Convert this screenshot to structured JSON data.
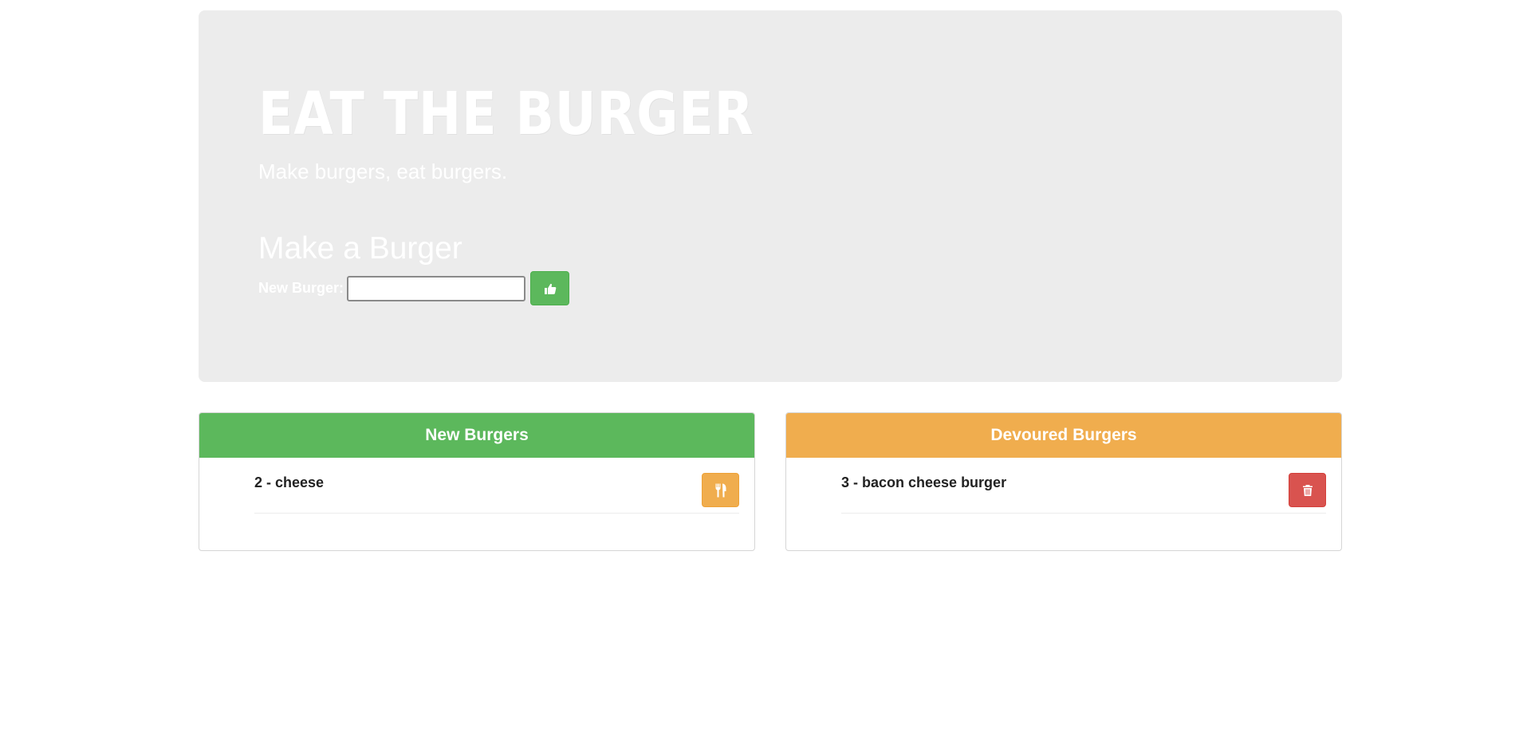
{
  "header": {
    "title": "EAT THE BURGER",
    "subtitle": "Make burgers, eat burgers."
  },
  "form": {
    "heading": "Make a Burger",
    "label": "New Burger:",
    "input_value": "",
    "input_placeholder": "",
    "submit_icon": "thumbs-up-icon"
  },
  "new_burgers": {
    "heading": "New Burgers",
    "items": [
      {
        "label": "2 - cheese",
        "action_icon": "cutlery-icon"
      }
    ]
  },
  "devoured_burgers": {
    "heading": "Devoured Burgers",
    "items": [
      {
        "label": "3 - bacon cheese burger",
        "action_icon": "trash-icon"
      }
    ]
  },
  "colors": {
    "jumbotron_bg": "#ececec",
    "success": "#5cb85c",
    "warning": "#f0ad4e",
    "danger": "#d9534f"
  }
}
